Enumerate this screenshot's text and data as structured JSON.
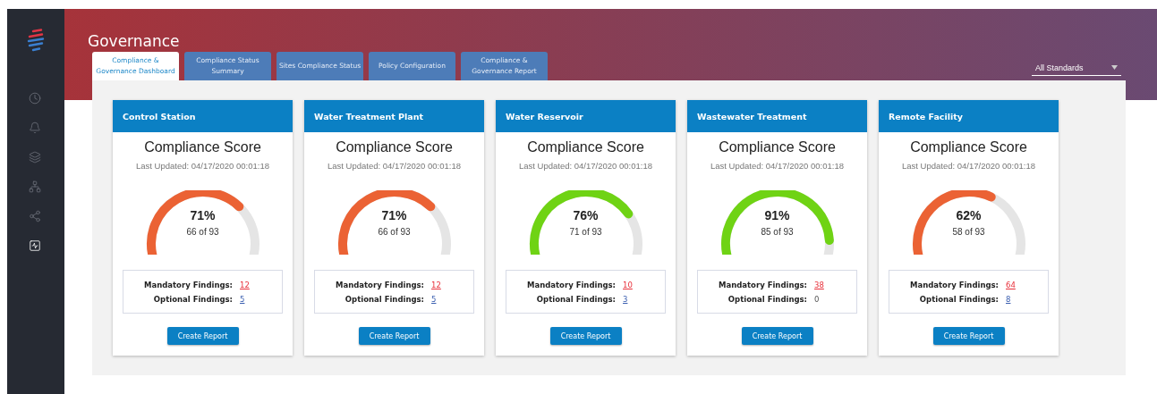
{
  "sidebar": {
    "items": [
      {
        "kind": "clock",
        "selected": false
      },
      {
        "kind": "bell",
        "selected": false
      },
      {
        "kind": "layers",
        "selected": false
      },
      {
        "kind": "network",
        "selected": false
      },
      {
        "kind": "share",
        "selected": false
      },
      {
        "kind": "activity",
        "selected": true
      }
    ]
  },
  "header": {
    "title": "Governance",
    "filter": {
      "value": "All Standards"
    }
  },
  "tabs": [
    {
      "label": "Compliance & Governance Dashboard",
      "selected": true
    },
    {
      "label": "Compliance Status Summary",
      "selected": false
    },
    {
      "label": "Sites Compliance Status",
      "selected": false
    },
    {
      "label": "Policy Configuration",
      "selected": false
    },
    {
      "label": "Compliance & Governance Report",
      "selected": false
    }
  ],
  "cards": [
    {
      "title": "Control Station",
      "heading": "Compliance Score",
      "updated": "Last Updated: 04/17/2020 00:01:18",
      "percent": "71%",
      "count": "66 of 93",
      "color": "#eb6234",
      "mandatory_label": "Mandatory Findings:",
      "mandatory": "12",
      "optional_label": "Optional Findings:",
      "optional": "5",
      "optional_link": true,
      "button": "Create Report"
    },
    {
      "title": "Water Treatment Plant",
      "heading": "Compliance Score",
      "updated": "Last Updated: 04/17/2020 00:01:18",
      "percent": "71%",
      "count": "66 of 93",
      "color": "#eb6234",
      "mandatory_label": "Mandatory Findings:",
      "mandatory": "12",
      "optional_label": "Optional Findings:",
      "optional": "5",
      "optional_link": true,
      "button": "Create Report"
    },
    {
      "title": "Water Reservoir",
      "heading": "Compliance Score",
      "updated": "Last Updated: 04/17/2020 00:01:18",
      "percent": "76%",
      "count": "71 of 93",
      "color": "#6fd314",
      "mandatory_label": "Mandatory Findings:",
      "mandatory": "10",
      "optional_label": "Optional Findings:",
      "optional": "3",
      "optional_link": true,
      "button": "Create Report"
    },
    {
      "title": "Wastewater Treatment",
      "heading": "Compliance Score",
      "updated": "Last Updated: 04/17/2020 00:01:18",
      "percent": "91%",
      "count": "85 of 93",
      "color": "#6fd314",
      "mandatory_label": "Mandatory Findings:",
      "mandatory": "38",
      "optional_label": "Optional Findings:",
      "optional": "0",
      "optional_link": false,
      "button": "Create Report"
    },
    {
      "title": "Remote Facility",
      "heading": "Compliance Score",
      "updated": "Last Updated: 04/17/2020 00:01:18",
      "percent": "62%",
      "count": "58 of 93",
      "color": "#eb6234",
      "mandatory_label": "Mandatory Findings:",
      "mandatory": "64",
      "optional_label": "Optional Findings:",
      "optional": "8",
      "optional_link": true,
      "button": "Create Report"
    }
  ]
}
